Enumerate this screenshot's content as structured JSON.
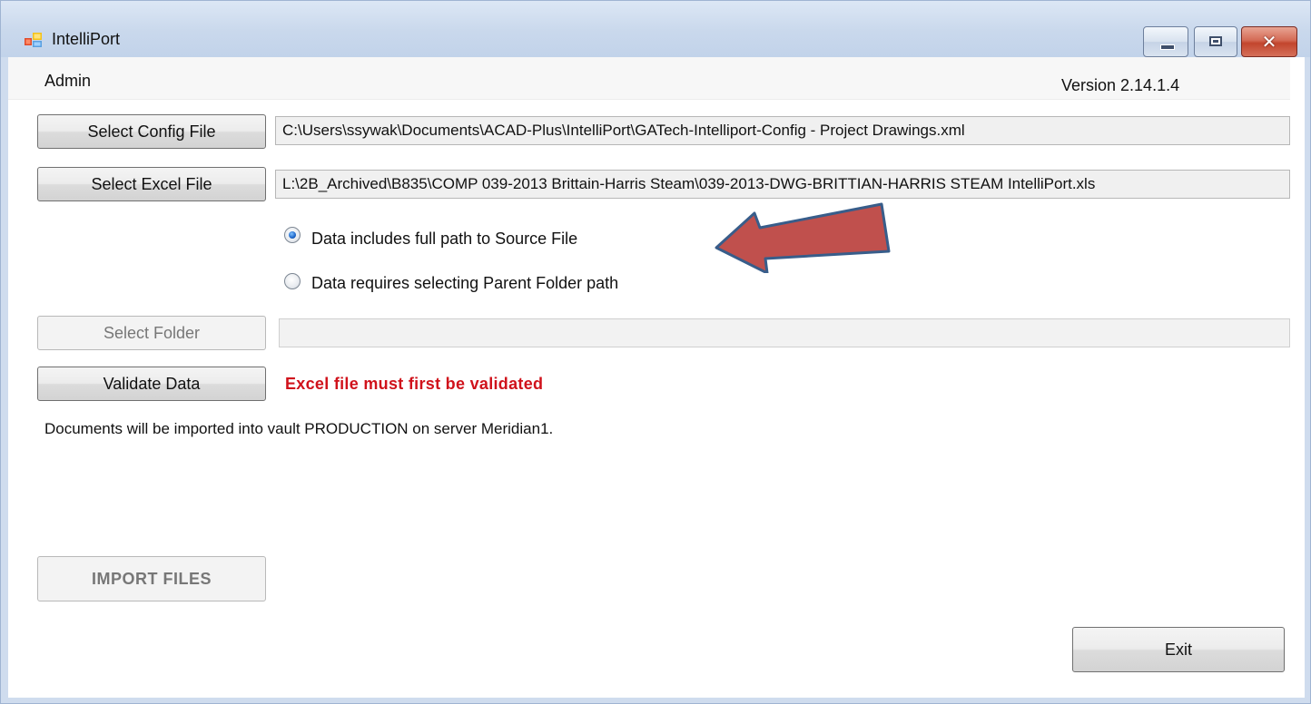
{
  "window": {
    "title": "IntelliPort",
    "controls": {
      "minimize": "minimize",
      "maximize": "maximize",
      "close": "close"
    }
  },
  "menu": {
    "admin_label": "Admin",
    "version": "Version 2.14.1.4"
  },
  "config": {
    "button_label": "Select Config File",
    "path": "C:\\Users\\ssywak\\Documents\\ACAD-Plus\\IntelliPort\\GATech-Intelliport-Config - Project Drawings.xml"
  },
  "excel": {
    "button_label": "Select Excel File",
    "path": "L:\\2B_Archived\\B835\\COMP 039-2013 Brittain-Harris Steam\\039-2013-DWG-BRITTIAN-HARRIS STEAM IntelliPort.xls"
  },
  "path_mode": {
    "options": [
      {
        "label": "Data includes full path to Source File",
        "selected": true
      },
      {
        "label": "Data requires selecting Parent Folder path",
        "selected": false
      }
    ]
  },
  "folder": {
    "button_label": "Select Folder",
    "path": "",
    "enabled": false
  },
  "validate": {
    "button_label": "Validate Data",
    "status": "Excel file must first be validated"
  },
  "info_text": "Documents will be imported into vault PRODUCTION on server Meridian1.",
  "import": {
    "button_label": "IMPORT FILES",
    "enabled": false
  },
  "exit": {
    "button_label": "Exit"
  },
  "colors": {
    "warning": "#d0121b",
    "arrow_fill": "#c0504d",
    "arrow_stroke": "#385d8a"
  },
  "icons": {
    "app": "app-window-icon",
    "annotation": "red-arrow-icon"
  }
}
